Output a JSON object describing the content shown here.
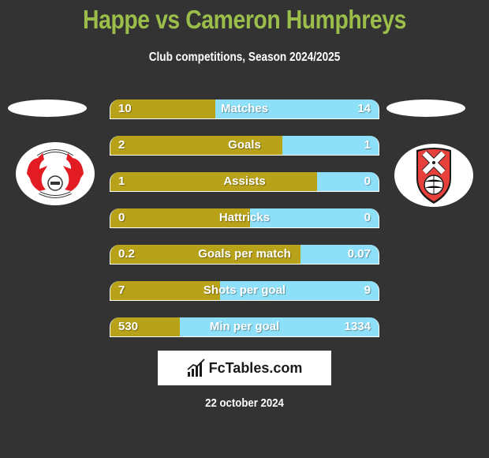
{
  "header": {
    "title": "Happe vs Cameron Humphreys",
    "subtitle": "Club competitions, Season 2024/2025"
  },
  "teams": {
    "left": {
      "badge": "leyton-orient-crest",
      "colors": [
        "#e31b23",
        "#ffffff"
      ]
    },
    "right": {
      "badge": "rotherham-united-crest",
      "colors": [
        "#e8413b",
        "#ffffff"
      ]
    }
  },
  "colors": {
    "title": "#9bbe4a",
    "left_bar": "#b8a219",
    "right_bar": "#8ee0f8",
    "background": "#333333"
  },
  "stats": [
    {
      "label": "Matches",
      "left": "10",
      "right": "14",
      "left_share": 0.39
    },
    {
      "label": "Goals",
      "left": "2",
      "right": "1",
      "left_share": 0.64
    },
    {
      "label": "Assists",
      "left": "1",
      "right": "0",
      "left_share": 0.77
    },
    {
      "label": "Hattricks",
      "left": "0",
      "right": "0",
      "left_share": 0.52
    },
    {
      "label": "Goals per match",
      "left": "0.2",
      "right": "0.07",
      "left_share": 0.71
    },
    {
      "label": "Shots per goal",
      "left": "7",
      "right": "9",
      "left_share": 0.41
    },
    {
      "label": "Min per goal",
      "left": "530",
      "right": "1334",
      "left_share": 0.26
    }
  ],
  "footer": {
    "brand": "FcTables.com",
    "date": "22 october 2024"
  }
}
